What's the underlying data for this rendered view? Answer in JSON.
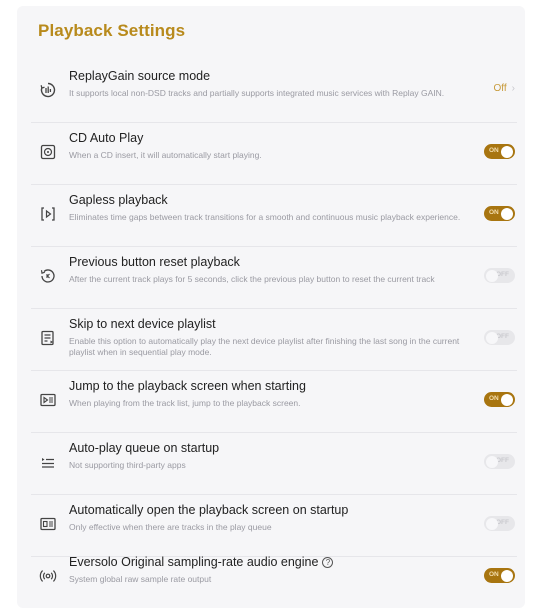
{
  "page": {
    "title": "Playback Settings"
  },
  "settings": [
    {
      "label": "ReplayGain source mode",
      "description": "It supports local non-DSD tracks and partially supports integrated music services with Replay GAIN.",
      "control": "value",
      "value": "Off",
      "icon": "replaygain-icon"
    },
    {
      "label": "CD Auto Play",
      "description": "When a CD insert, it will automatically start playing.",
      "control": "toggle",
      "state": "ON",
      "icon": "cd-icon"
    },
    {
      "label": "Gapless playback",
      "description": "Eliminates time gaps between track transitions for a smooth and continuous music playback experience.",
      "control": "toggle",
      "state": "ON",
      "icon": "gapless-icon"
    },
    {
      "label": "Previous button reset playback",
      "description": "After the current track plays for 5 seconds, click the previous play button to reset the current track",
      "control": "toggle",
      "state": "OFF",
      "icon": "replay-icon"
    },
    {
      "label": "Skip to next device playlist",
      "description": "Enable this option to automatically play the next device playlist after finishing the last song in the current playlist when in sequential play mode.",
      "control": "toggle",
      "state": "OFF",
      "icon": "playlist-icon"
    },
    {
      "label": "Jump to the playback screen when starting",
      "description": "When playing from the track list, jump to the playback screen.",
      "control": "toggle",
      "state": "ON",
      "icon": "playback-screen-icon"
    },
    {
      "label": "Auto-play queue on startup",
      "description": "Not supporting third-party apps",
      "control": "toggle",
      "state": "OFF",
      "icon": "queue-icon"
    },
    {
      "label": "Automatically open the playback screen on startup",
      "description": "Only effective when there are tracks in the play queue",
      "control": "toggle",
      "state": "OFF",
      "icon": "open-screen-icon"
    },
    {
      "label": "Eversolo Original sampling-rate audio engine",
      "description": "System global raw sample rate output",
      "control": "toggle",
      "state": "ON",
      "icon": "audio-engine-icon",
      "help": "?"
    }
  ],
  "colors": {
    "accent": "#b88a1c",
    "toggle_on": "#a87510",
    "toggle_off": "#e7e7ea"
  }
}
